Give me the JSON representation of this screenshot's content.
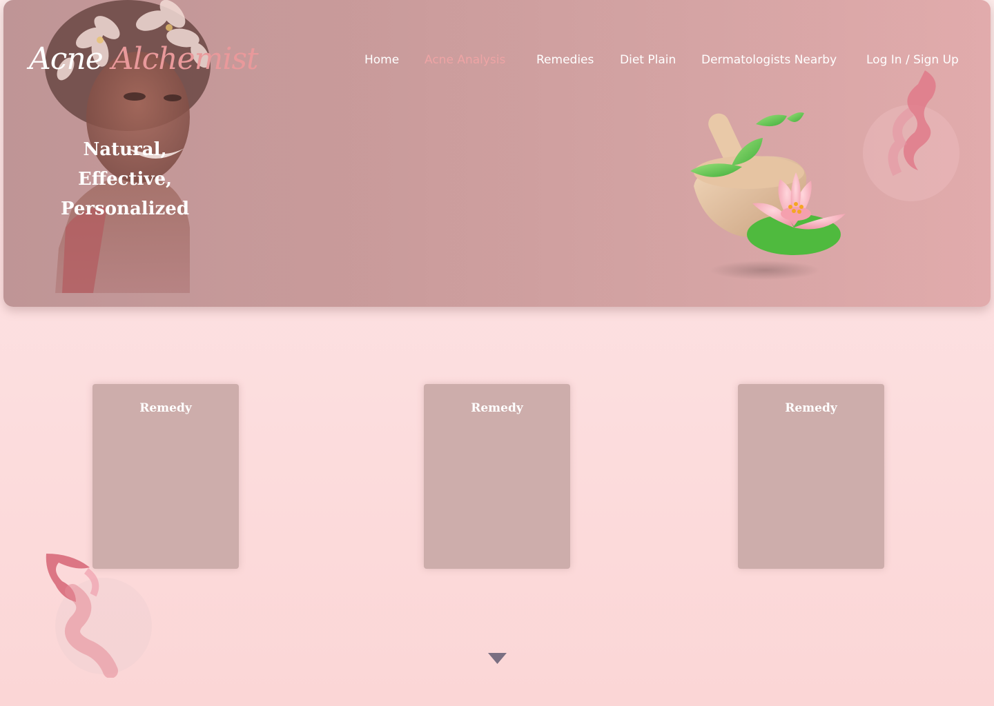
{
  "logo": {
    "part1": "Acne",
    "part2": "Alchemist"
  },
  "nav": {
    "items": [
      {
        "label": "Home",
        "active": false
      },
      {
        "label": "Acne Analysis",
        "active": true
      },
      {
        "label": "Remedies",
        "active": false
      },
      {
        "label": "Diet Plain",
        "active": false
      },
      {
        "label": "Dermatologists Nearby",
        "active": false
      },
      {
        "label": "Log In / Sign Up",
        "active": false
      }
    ]
  },
  "hero": {
    "tagline": [
      "Natural,",
      "Effective,",
      "Personalized"
    ]
  },
  "cards": [
    {
      "title": "Remedy"
    },
    {
      "title": "Remedy"
    },
    {
      "title": "Remedy"
    }
  ],
  "colors": {
    "accent": "#e9999b",
    "hero_background": "#c99b9b",
    "card_background": "#cdadab",
    "page_background": "#fde1e2"
  },
  "icons": {
    "scroll": "triangle-down-icon"
  }
}
